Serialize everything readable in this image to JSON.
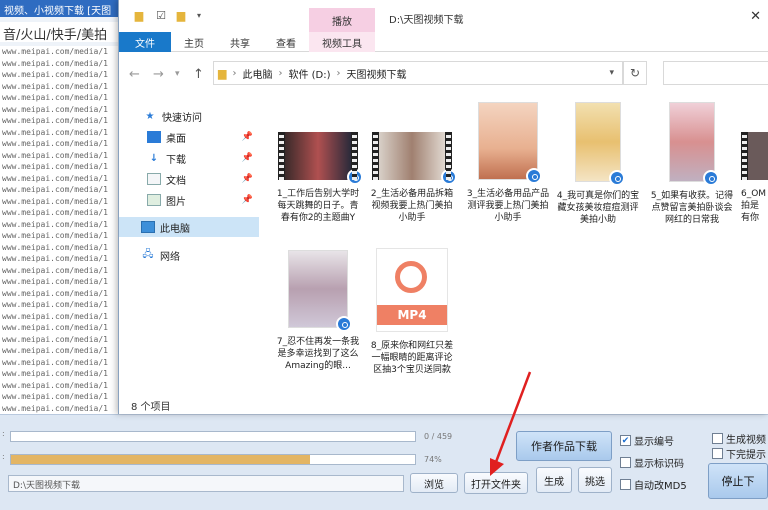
{
  "bg_app": {
    "title": "视频、小视频下载 [天图",
    "platforms": "音/火山/快手/美拍",
    "url_lines": [
      "www.meipai.com/media/1",
      "www.meipai.com/media/1",
      "www.meipai.com/media/1",
      "www.meipai.com/media/1",
      "www.meipai.com/media/1",
      "www.meipai.com/media/1",
      "www.meipai.com/media/1",
      "www.meipai.com/media/1",
      "www.meipai.com/media/1",
      "www.meipai.com/media/1",
      "www.meipai.com/media/1",
      "www.meipai.com/media/1",
      "www.meipai.com/media/1",
      "www.meipai.com/media/1",
      "www.meipai.com/media/1",
      "www.meipai.com/media/1",
      "www.meipai.com/media/1",
      "www.meipai.com/media/1",
      "www.meipai.com/media/1",
      "www.meipai.com/media/1",
      "www.meipai.com/media/1",
      "www.meipai.com/media/1",
      "www.meipai.com/media/1",
      "www.meipai.com/media/1",
      "www.meipai.com/media/1",
      "www.meipai.com/media/1",
      "www.meipai.com/media/1",
      "www.meipai.com/media/1",
      "www.meipai.com/media/1",
      "www.meipai.com/media/1",
      "www.meipai.com/media/1",
      "www.meipai.com/media/1"
    ]
  },
  "panel": {
    "progress1_text": "0 / 459",
    "progress2_text": "74%",
    "progress1_fraction": 0.0,
    "progress2_fraction": 0.74,
    "path_value": "D:\\天图视频下载",
    "browse_label": "浏览",
    "open_folder_label": "打开文件夹",
    "author_download_label": "作者作品下载",
    "generate_label": "生成",
    "select_label": "挑选",
    "stop_label": "停止下",
    "chk_show_number": "显示编号",
    "chk_show_tag": "显示标识码",
    "chk_auto_md5": "自动改MD5",
    "chk_gen_video": "生成视频",
    "chk_no_prompt": "下完提示"
  },
  "explorer": {
    "context_tab_header": "播放",
    "window_title": "D:\\天图视频下载",
    "close_glyph": "✕",
    "ribbon_tabs": [
      "文件",
      "主页",
      "共享",
      "查看",
      "视频工具"
    ],
    "address_parts": [
      "此电脑",
      "软件 (D:)",
      "天图视频下载"
    ],
    "nav_items": [
      {
        "label": "快速访问",
        "icon": "star-icon"
      },
      {
        "label": "桌面",
        "icon": "desktop-icon"
      },
      {
        "label": "下载",
        "icon": "download-icon"
      },
      {
        "label": "文档",
        "icon": "document-icon"
      },
      {
        "label": "图片",
        "icon": "picture-icon"
      },
      {
        "label": "此电脑",
        "icon": "computer-icon"
      },
      {
        "label": "网络",
        "icon": "network-icon"
      }
    ],
    "status": "8 个项目",
    "files": [
      {
        "name": "1_工作后告别大学时每天跳舞的日子。青春有你2的主题曲Y"
      },
      {
        "name": "2_生活必备用品拆箱视频我要上热门美拍小助手"
      },
      {
        "name": "3_生活必备用品产品测评我要上热门美拍小助手"
      },
      {
        "name": "4_我可真是你们的宝藏女孩美妆痘痘测评美拍小助"
      },
      {
        "name": "5_如果有收获。记得点赞留言美拍卧谈会网红的日常我"
      },
      {
        "name": "6_OM拍是有你"
      },
      {
        "name": "7_忍不住再发一条我是多幸运找到了这么Amazing的眼..."
      },
      {
        "name": "8_原来你和网红只差一幅眼睛的距离评论区抽3个宝贝送同款"
      }
    ],
    "mp4_label": "MP4"
  }
}
